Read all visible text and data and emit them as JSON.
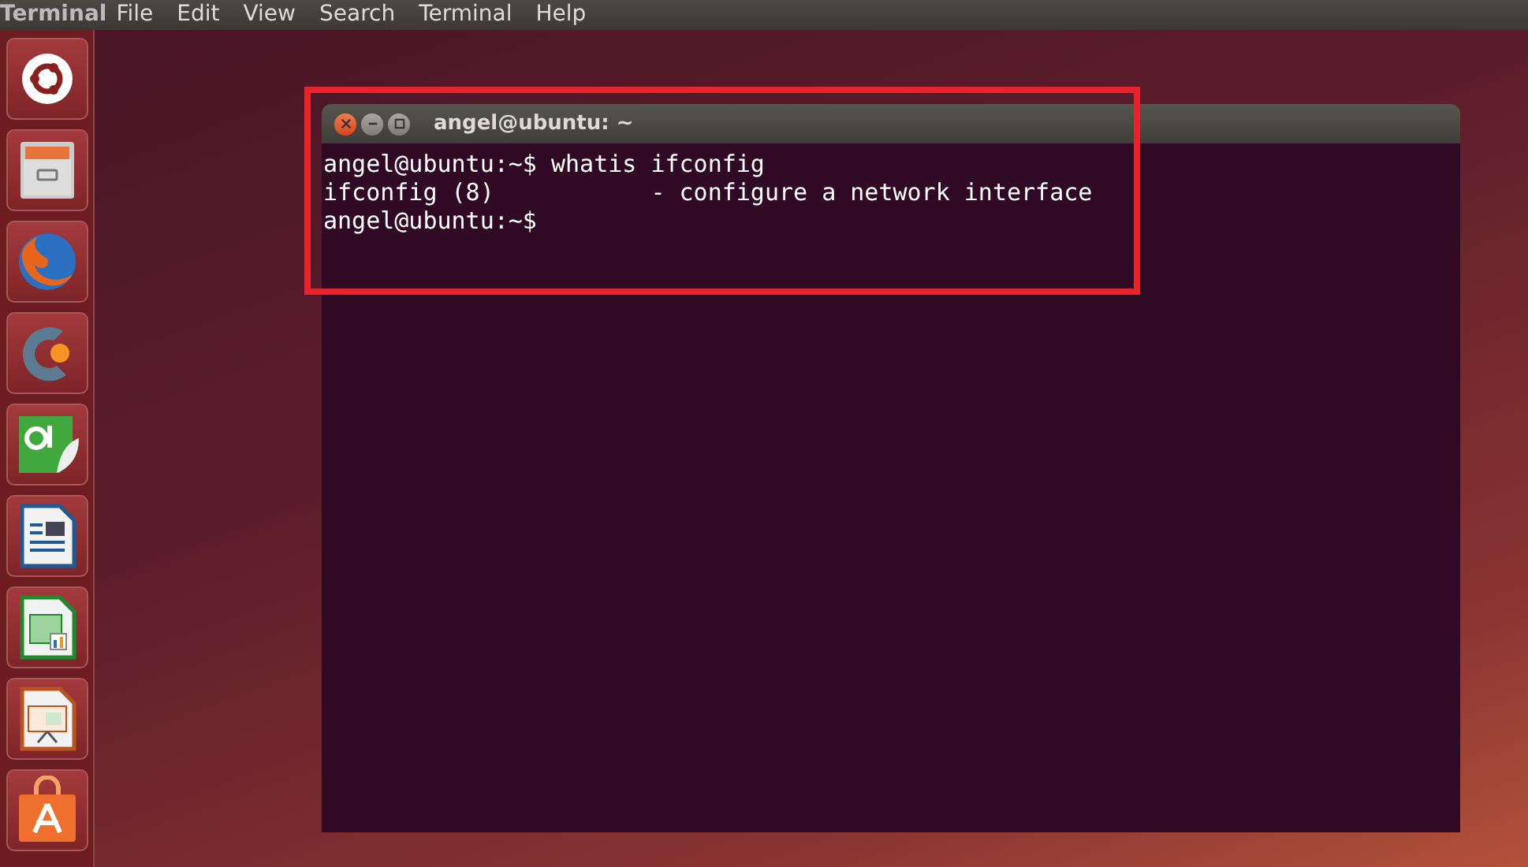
{
  "top_bar": {
    "app_name": "Terminal",
    "menus": [
      "File",
      "Edit",
      "View",
      "Search",
      "Terminal",
      "Help"
    ]
  },
  "launcher": [
    {
      "kind": "ubuntu"
    },
    {
      "kind": "files"
    },
    {
      "kind": "firefox"
    },
    {
      "kind": "ide"
    },
    {
      "kind": "qt"
    },
    {
      "kind": "writer"
    },
    {
      "kind": "calc"
    },
    {
      "kind": "impress"
    },
    {
      "kind": "software"
    }
  ],
  "terminal": {
    "title": "angel@ubuntu: ~",
    "lines": [
      "angel@ubuntu:~$ whatis ifconfig",
      "ifconfig (8)           - configure a network interface",
      "angel@ubuntu:~$"
    ]
  },
  "highlight_box": true
}
